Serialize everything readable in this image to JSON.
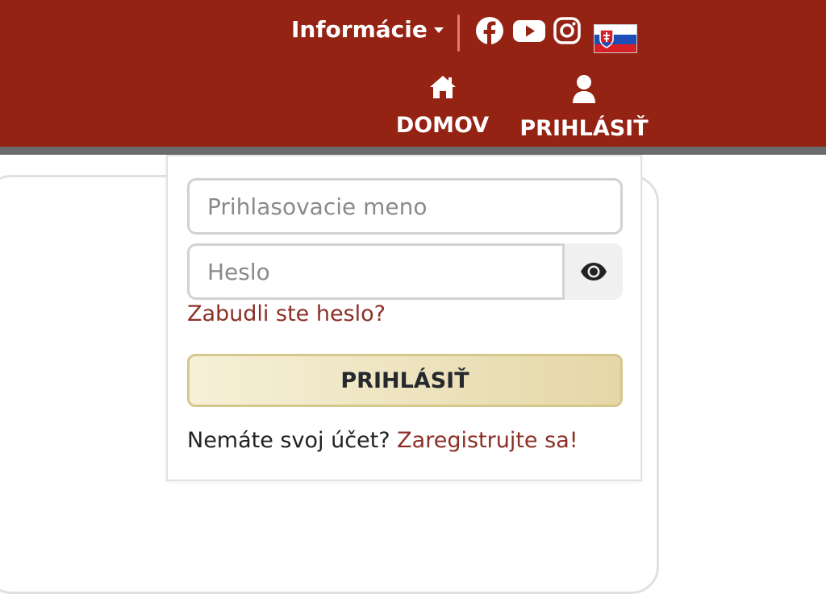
{
  "header": {
    "info_menu_label": "Informácie",
    "social": [
      "facebook-icon",
      "youtube-icon",
      "instagram-icon"
    ],
    "language": "slovak-flag",
    "nav": [
      {
        "label": "DOMOV",
        "icon": "home-icon"
      },
      {
        "label": "PRIHLÁSIŤ",
        "icon": "user-icon"
      }
    ]
  },
  "login": {
    "username_placeholder": "Prihlasovacie meno",
    "password_placeholder": "Heslo",
    "forgot_label": "Zabudli ste heslo?",
    "submit_label": "PRIHLÁSIŤ",
    "no_account_text": "Nemáte svoj účet?",
    "register_label": "Zaregistrujte sa!"
  },
  "colors": {
    "header_bg": "#952314",
    "link": "#8c2f26",
    "button_border": "#d5c88a"
  }
}
